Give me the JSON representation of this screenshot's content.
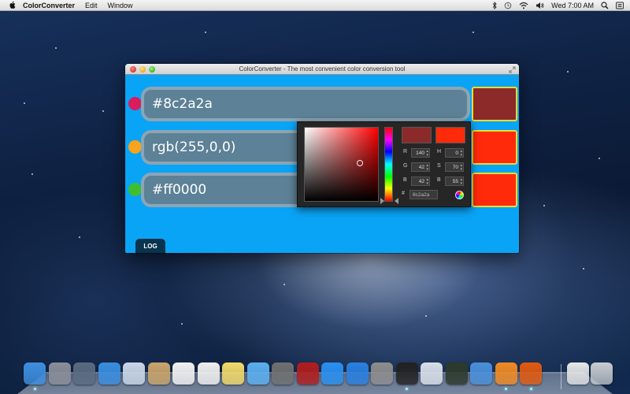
{
  "menubar": {
    "app_name": "ColorConverter",
    "menus": [
      "Edit",
      "Window"
    ],
    "clock": "Wed 7:00 AM"
  },
  "window": {
    "title": "ColorConverter - The most convenient color conversion tool"
  },
  "rows": [
    {
      "value": "#8c2a2a",
      "dot_color": "#d91c5c",
      "swatch_color": "#8c2a2a"
    },
    {
      "value": "rgb(255,0,0)",
      "dot_color": "#f7a31c",
      "swatch_color": "#ff2a0a"
    },
    {
      "value": "#ff0000",
      "dot_color": "#3fbf2f",
      "swatch_color": "#ff2a0a"
    }
  ],
  "log_tab": {
    "label": "LOG"
  },
  "color_picker": {
    "old_color": "#8c2a2a",
    "new_color": "#ff2a0a",
    "r_label": "R",
    "r_value": "140",
    "g_label": "G",
    "g_value": "42",
    "b_label": "B",
    "b_value": "42",
    "h_label": "H",
    "h_value": "0",
    "s_label": "S",
    "s_value": "70",
    "bv_label": "B",
    "bv_value": "55",
    "hex_label": "#",
    "hex_value": "8c2a2a"
  },
  "dock": {
    "apps": [
      {
        "icon": "finder-icon",
        "color": "#3f8fe0"
      },
      {
        "icon": "launchpad-icon",
        "color": "#8a8f99"
      },
      {
        "icon": "mission-control-icon",
        "color": "#5a6b80"
      },
      {
        "icon": "safari-icon",
        "color": "#3a8ee0"
      },
      {
        "icon": "mail-stamp-icon",
        "color": "#c9d7e8"
      },
      {
        "icon": "contacts-icon",
        "color": "#c9a46c"
      },
      {
        "icon": "calendar-icon",
        "color": "#f2f2f2"
      },
      {
        "icon": "reminders-icon",
        "color": "#f0f0f0"
      },
      {
        "icon": "notes-icon",
        "color": "#f2d96a"
      },
      {
        "icon": "messages-icon",
        "color": "#5cb0f0"
      },
      {
        "icon": "facetime-icon",
        "color": "#707070"
      },
      {
        "icon": "photo-booth-icon",
        "color": "#b01e1e"
      },
      {
        "icon": "itunes-icon",
        "color": "#2a8ff0"
      },
      {
        "icon": "app-store-icon",
        "color": "#2a7fe0"
      },
      {
        "icon": "system-preferences-icon",
        "color": "#8d8d8d"
      },
      {
        "icon": "terminal-icon",
        "color": "#222222"
      },
      {
        "icon": "preview-icon",
        "color": "#d8dfe8"
      },
      {
        "icon": "activity-monitor-icon",
        "color": "#2d3a2d"
      },
      {
        "icon": "xcode-icon",
        "color": "#4a90d9"
      },
      {
        "icon": "sublime-text-icon",
        "color": "#f08a24"
      },
      {
        "icon": "color-converter-icon",
        "color": "#e05a10"
      }
    ],
    "stack": [
      {
        "icon": "documents-stack-icon",
        "color": "#e8e8e8"
      },
      {
        "icon": "trash-icon",
        "color": "#c8ccd0"
      }
    ],
    "running_indices": [
      0,
      15,
      19,
      20
    ]
  }
}
